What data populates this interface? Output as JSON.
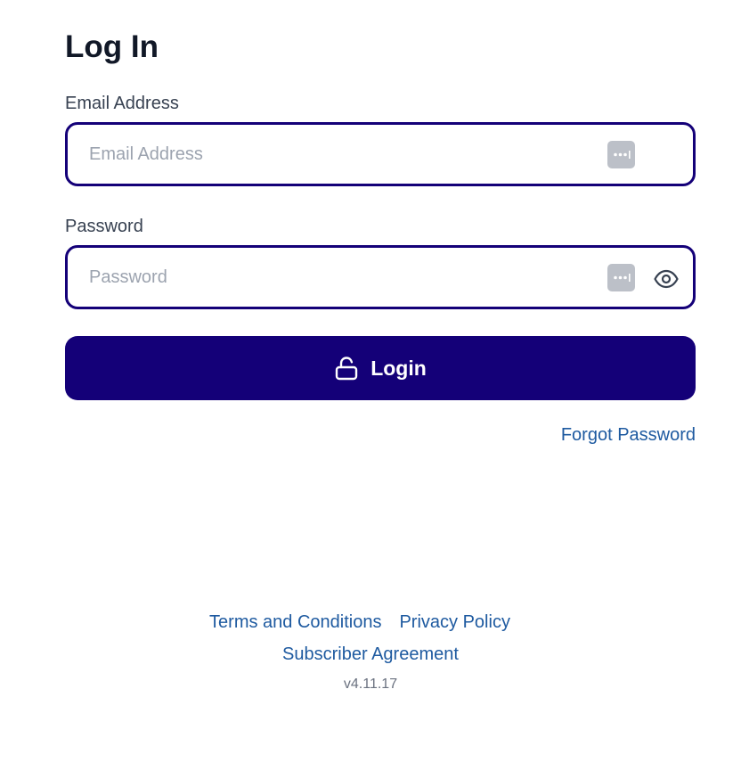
{
  "page": {
    "title": "Log In"
  },
  "email": {
    "label": "Email Address",
    "placeholder": "Email Address",
    "value": ""
  },
  "password": {
    "label": "Password",
    "placeholder": "Password",
    "value": ""
  },
  "login_button": {
    "label": "Login",
    "icon": "unlock-icon"
  },
  "forgot_password": {
    "label": "Forgot Password"
  },
  "footer": {
    "terms": "Terms and Conditions",
    "privacy": "Privacy Policy",
    "subscriber": "Subscriber Agreement",
    "version": "v4.11.17"
  },
  "colors": {
    "accent": "#140078",
    "link": "#1e5aa0",
    "heading": "#111827",
    "placeholder": "#9ca3af"
  }
}
